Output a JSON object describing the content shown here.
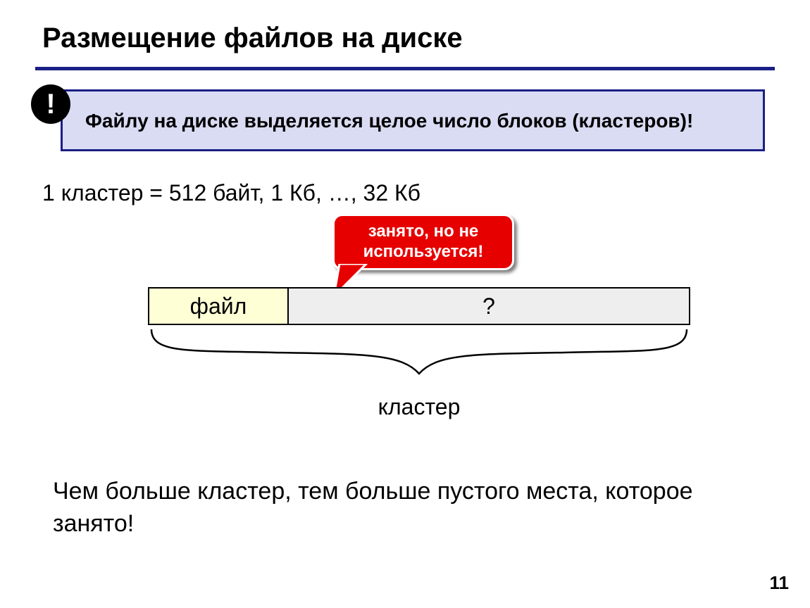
{
  "title": "Размещение файлов на диске",
  "callout": {
    "badge": "!",
    "text": "Файлу на диске выделяется целое число блоков (кластеров)!"
  },
  "cluster_size_line": "1 кластер = 512 байт, 1 Кб, …, 32 Кб",
  "bubble_text": "занято, но не используется!",
  "bar": {
    "file_label": "файл",
    "rest_label": "?"
  },
  "brace_label": "кластер",
  "conclusion": "Чем больше кластер, тем больше пустого места, которое занято!",
  "page_number": "11"
}
